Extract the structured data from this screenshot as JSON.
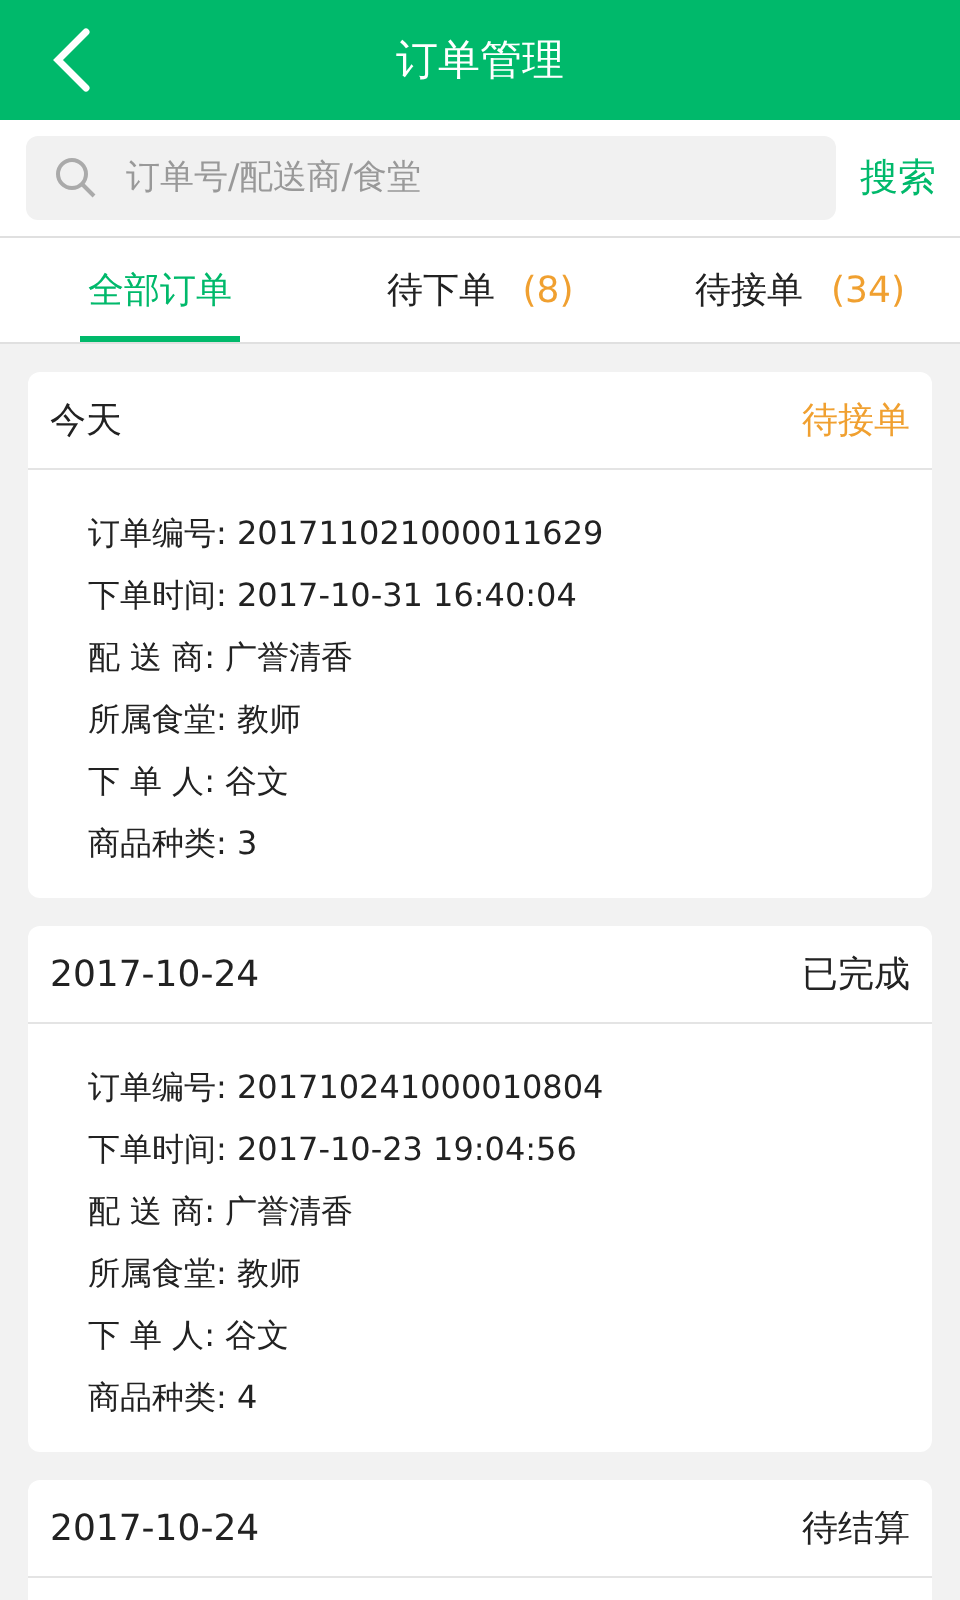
{
  "header": {
    "title": "订单管理"
  },
  "search": {
    "placeholder": "订单号/配送商/食堂",
    "button": "搜索"
  },
  "tabs": [
    {
      "label": "全部订单",
      "selected": true
    },
    {
      "label": "待下单",
      "count": "(8)",
      "selected": false
    },
    {
      "label": "待接单",
      "count": "(34)",
      "selected": false
    }
  ],
  "orders": [
    {
      "date": "今天",
      "status": "待接单",
      "kind": "pending",
      "lines": [
        "订单编号: 201711021000011629",
        "下单时间: 2017-10-31 16:40:04",
        "配 送 商: 广誉清香",
        "所属食堂: 教师",
        "下 单 人: 谷文",
        "商品种类: 3"
      ]
    },
    {
      "date": "2017-10-24",
      "status": "已完成",
      "kind": "done",
      "lines": [
        "订单编号: 201710241000010804",
        "下单时间: 2017-10-23 19:04:56",
        "配 送 商: 广誉清香",
        "所属食堂: 教师",
        "下 单 人: 谷文",
        "商品种类: 4"
      ]
    },
    {
      "date": "2017-10-24",
      "status": "待结算",
      "kind": "settle"
    }
  ]
}
